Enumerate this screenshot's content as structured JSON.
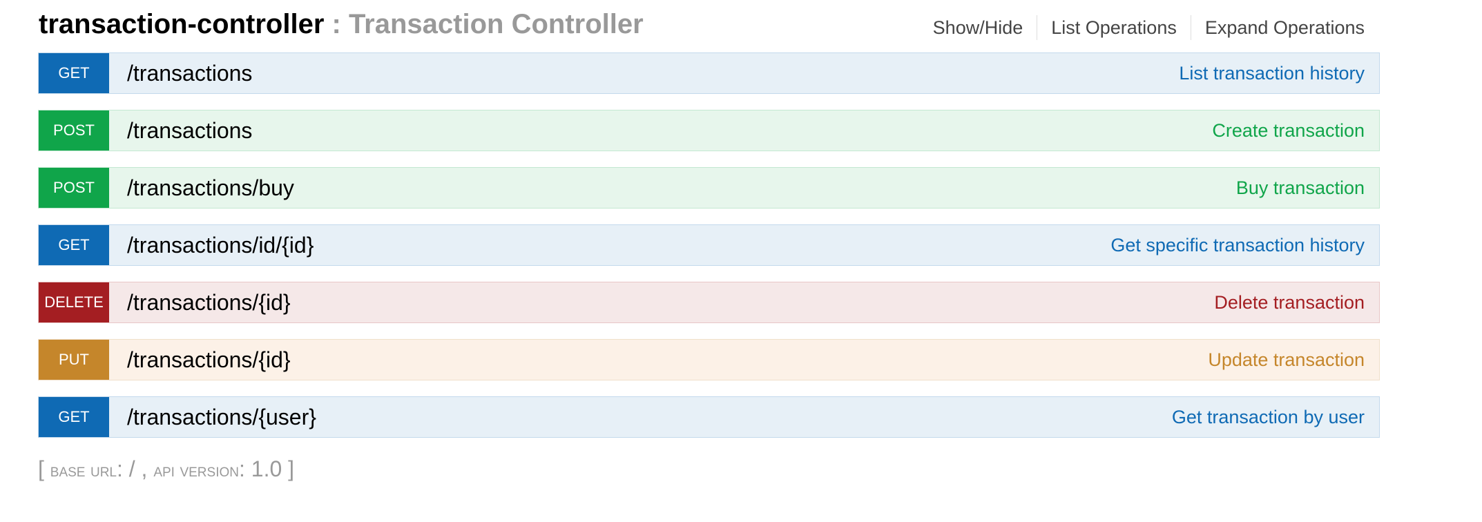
{
  "resource": {
    "name": "transaction-controller",
    "separator": " : ",
    "description": "Transaction Controller",
    "options": [
      "Show/Hide",
      "List Operations",
      "Expand Operations"
    ]
  },
  "operations": [
    {
      "method": "GET",
      "path": "/transactions",
      "summary": "List transaction history"
    },
    {
      "method": "POST",
      "path": "/transactions",
      "summary": "Create transaction"
    },
    {
      "method": "POST",
      "path": "/transactions/buy",
      "summary": "Buy transaction"
    },
    {
      "method": "GET",
      "path": "/transactions/id/{id}",
      "summary": "Get specific transaction history"
    },
    {
      "method": "DELETE",
      "path": "/transactions/{id}",
      "summary": "Delete transaction"
    },
    {
      "method": "PUT",
      "path": "/transactions/{id}",
      "summary": "Update transaction"
    },
    {
      "method": "GET",
      "path": "/transactions/{user}",
      "summary": "Get transaction by user"
    }
  ],
  "footer": {
    "open": "[ ",
    "base_url_label": "Base url",
    "base_url_value": ": / , ",
    "api_version_label": "Api version",
    "api_version_value": ": 1.0 ",
    "close": "]"
  },
  "colors": {
    "get": "#0f6ab4",
    "post": "#10a54a",
    "delete": "#a41e22",
    "put": "#c5862b"
  }
}
